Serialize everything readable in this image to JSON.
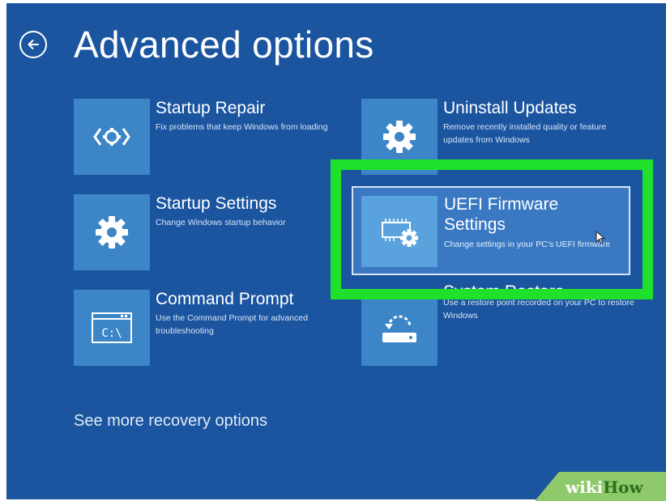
{
  "header": {
    "title": "Advanced options",
    "back_icon": "back-arrow-icon"
  },
  "options": [
    {
      "id": "startup-repair",
      "name": "Startup Repair",
      "description": "Fix problems that keep Windows from loading",
      "icon": "startup-repair-icon"
    },
    {
      "id": "startup-settings",
      "name": "Startup Settings",
      "description": "Change Windows startup behavior",
      "icon": "gear-icon"
    },
    {
      "id": "command-prompt",
      "name": "Command Prompt",
      "description": "Use the Command Prompt for advanced troubleshooting",
      "icon": "command-prompt-icon",
      "icon_text": "C:\\"
    },
    {
      "id": "uninstall-updates",
      "name": "Uninstall Updates",
      "description": "Remove recently installed quality or feature updates from Windows",
      "icon": "gear-icon"
    },
    {
      "id": "uefi-firmware-settings",
      "name": "UEFI Firmware Settings",
      "description": "Change settings in your PC's UEFI firmware",
      "icon": "chip-gear-icon",
      "highlighted": true
    },
    {
      "id": "system-restore",
      "name": "System Restore",
      "description": "Use a restore point recorded on your PC to restore Windows",
      "icon": "system-restore-icon"
    }
  ],
  "footer": {
    "more_link": "See more recovery options"
  },
  "watermark": {
    "part1": "wiki",
    "part2": "How"
  },
  "colors": {
    "background": "#1b55a0",
    "tile": "#3c86c8",
    "highlight_outline": "#1fe12c",
    "watermark_bg": "#8ec96b"
  }
}
